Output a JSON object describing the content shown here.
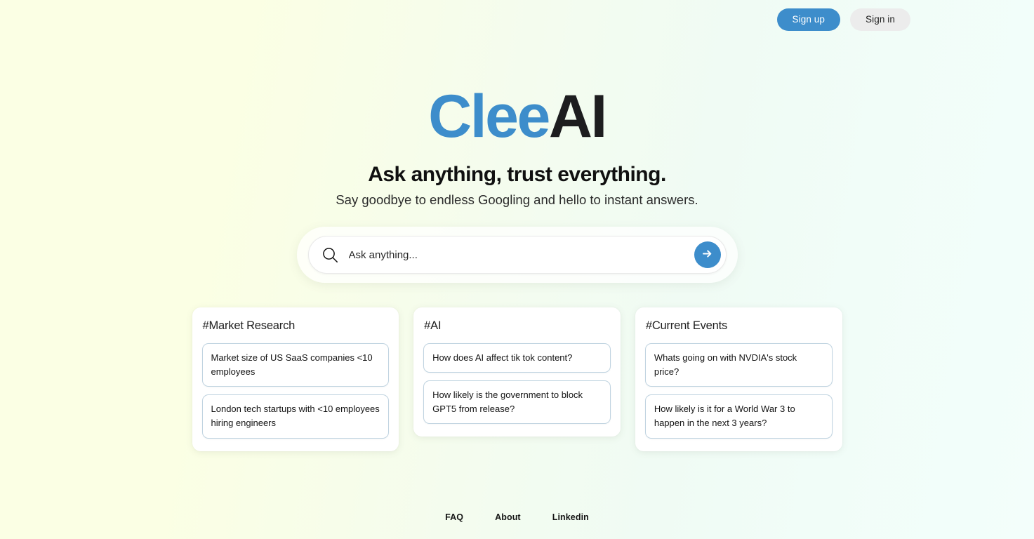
{
  "brand": {
    "logo_primary": "Clee",
    "logo_secondary": "AI",
    "color_primary": "#3d8dcb",
    "color_secondary": "#1d1d1f"
  },
  "topbar": {
    "sign_up_label": "Sign up",
    "sign_in_label": "Sign in"
  },
  "hero": {
    "headline": "Ask anything, trust everything.",
    "subheadline": "Say goodbye to endless Googling and hello to instant answers."
  },
  "search": {
    "value": "",
    "placeholder": "Ask anything...",
    "icon": "search-icon",
    "submit_icon": "arrow-right-icon",
    "submit_color": "#3d8dcb"
  },
  "cards": [
    {
      "title": "#Market Research",
      "suggestions": [
        "Market size of US SaaS companies <10 employees",
        "London tech startups with <10 employees hiring engineers"
      ]
    },
    {
      "title": "#AI",
      "suggestions": [
        "How does AI affect tik tok content?",
        "How likely is the government to block GPT5 from release?"
      ]
    },
    {
      "title": "#Current Events",
      "suggestions": [
        "Whats going on with NVDIA's stock price?",
        "How likely is it for a World War 3 to happen in the next 3 years?"
      ]
    }
  ],
  "footer": {
    "links": [
      {
        "label": "FAQ"
      },
      {
        "label": "About"
      },
      {
        "label": "Linkedin"
      }
    ]
  }
}
